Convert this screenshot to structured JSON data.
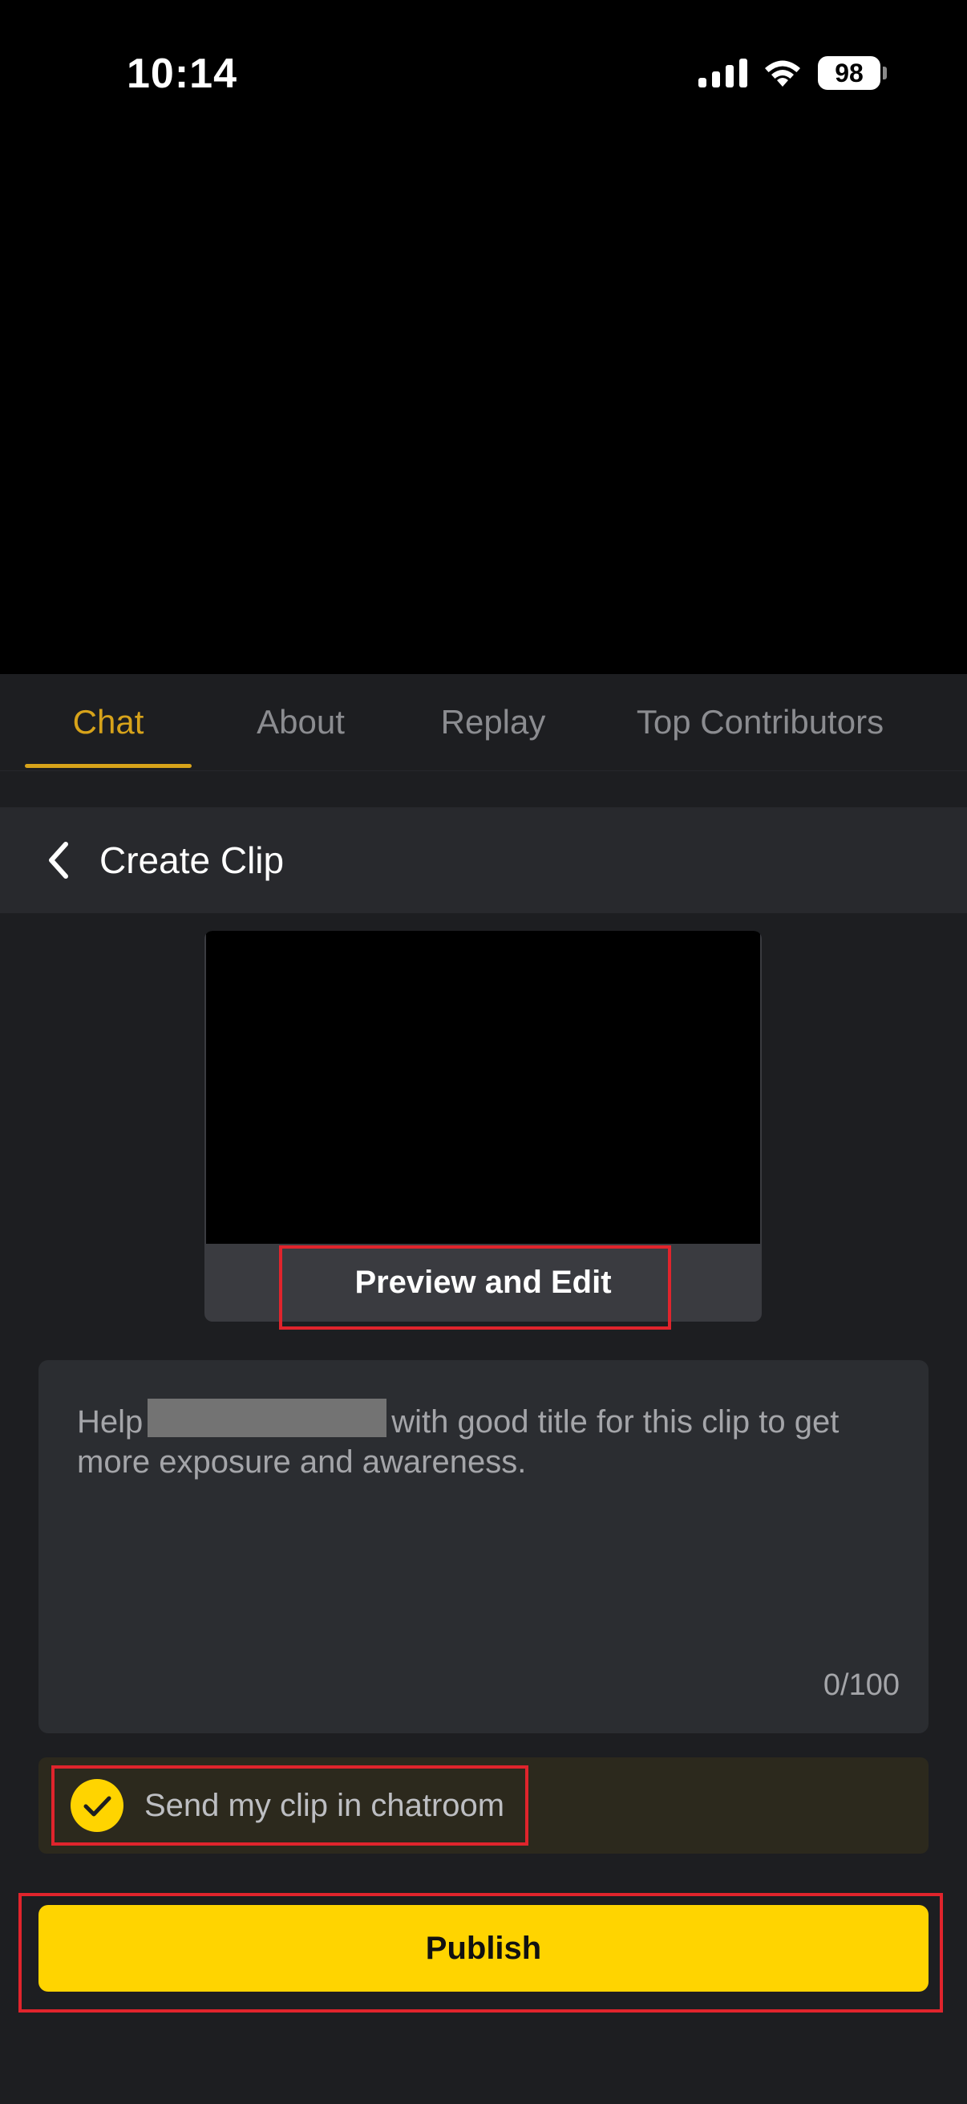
{
  "status_bar": {
    "time": "10:14",
    "battery": "98"
  },
  "tabs": [
    {
      "label": "Chat",
      "active": true
    },
    {
      "label": "About",
      "active": false
    },
    {
      "label": "Replay",
      "active": false
    },
    {
      "label": "Top Contributors",
      "active": false
    }
  ],
  "header": {
    "title": "Create Clip"
  },
  "preview": {
    "button_label": "Preview and Edit"
  },
  "title_input": {
    "placeholder_start": "Help",
    "placeholder_end": "with good title for this clip to get more exposure and awareness.",
    "counter": "0/100"
  },
  "send_option": {
    "label": "Send my clip in chatroom",
    "checked": true
  },
  "publish": {
    "label": "Publish"
  },
  "colors": {
    "accent_yellow": "#ffd400",
    "tab_active": "#d7a31a",
    "highlight_red": "#e0242c"
  },
  "icons": [
    "signal-icon",
    "wifi-icon",
    "battery-icon",
    "back-chevron-icon",
    "checkmark-icon"
  ]
}
